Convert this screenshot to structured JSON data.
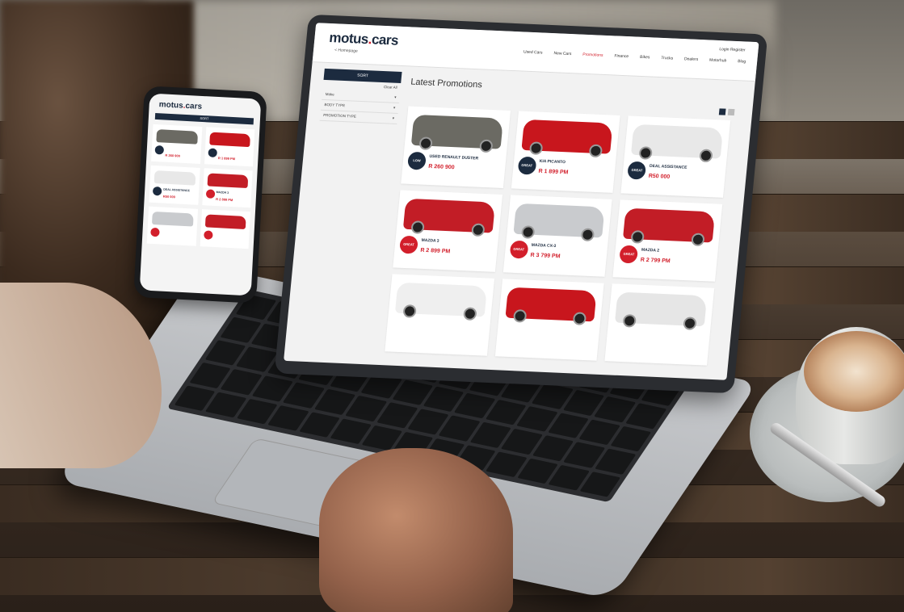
{
  "laptop": {
    "logo_text": "motus",
    "logo_suffix": "cars",
    "back_link": "< Homepage",
    "nav": [
      "Used Cars",
      "New Cars",
      "Promotions",
      "Finance",
      "Bikes",
      "Trucks",
      "Dealers",
      "Motorhub",
      "Blog"
    ],
    "login": "Login Register",
    "sort_label": "SORT",
    "clear_label": "Clear All",
    "filters": [
      "Make",
      "BODY TYPE",
      "PROMOTION TYPE"
    ],
    "page_title": "Latest Promotions",
    "cards": [
      {
        "name": "USED RENAULT DUSTER",
        "price": "R 260 900",
        "badge": "LOW MILEAGE",
        "color": "#1c2b3f",
        "car_color": "#6b6a63"
      },
      {
        "name": "KIA PICANTO",
        "price": "R 1 899 PM",
        "badge": "GREAT VALUE",
        "color": "#1c2b3f",
        "car_color": "#c8161d"
      },
      {
        "name": "DEAL ASSISTANCE",
        "price": "R50 000",
        "badge": "GREAT DEAL",
        "color": "#1c2b3f",
        "car_color": "#e8e8e8"
      },
      {
        "name": "MAZDA 3",
        "price": "R 2 899 PM",
        "badge": "GREAT DEAL",
        "color": "#d21f2b",
        "car_color": "#c21d26"
      },
      {
        "name": "MAZDA CX-3",
        "price": "R 3 799 PM",
        "badge": "GREAT DEAL",
        "color": "#d21f2b",
        "car_color": "#c9cbce"
      },
      {
        "name": "MAZDA 2",
        "price": "R 2 799 PM",
        "badge": "GREAT DEAL",
        "color": "#d21f2b",
        "car_color": "#c21d26"
      },
      {
        "name": "",
        "price": "",
        "badge": "",
        "color": "#ffffff",
        "car_color": "#efefef"
      },
      {
        "name": "",
        "price": "",
        "badge": "",
        "color": "#ffffff",
        "car_color": "#c8161d"
      },
      {
        "name": "",
        "price": "",
        "badge": "",
        "color": "#ffffff",
        "car_color": "#e6e6e6"
      }
    ]
  },
  "phone": {
    "logo_text": "motus",
    "logo_suffix": "cars",
    "bar_label": "SORT",
    "cards": [
      {
        "name": "",
        "price": "R 260 900",
        "car_color": "#6b6a63",
        "badge_color": "#1c2b3f"
      },
      {
        "name": "",
        "price": "R 1 899 PM",
        "car_color": "#c8161d",
        "badge_color": "#1c2b3f"
      },
      {
        "name": "DEAL ASSISTANCE",
        "price": "R50 000",
        "car_color": "#e8e8e8",
        "badge_color": "#1c2b3f"
      },
      {
        "name": "MAZDA 3",
        "price": "R 2 899 PM",
        "car_color": "#c21d26",
        "badge_color": "#d21f2b"
      },
      {
        "name": "",
        "price": "",
        "car_color": "#c9cbce",
        "badge_color": "#d21f2b"
      },
      {
        "name": "",
        "price": "",
        "car_color": "#c21d26",
        "badge_color": "#d21f2b"
      }
    ]
  },
  "colors": {
    "brand_navy": "#1c2b3f",
    "brand_red": "#d21f2b"
  }
}
